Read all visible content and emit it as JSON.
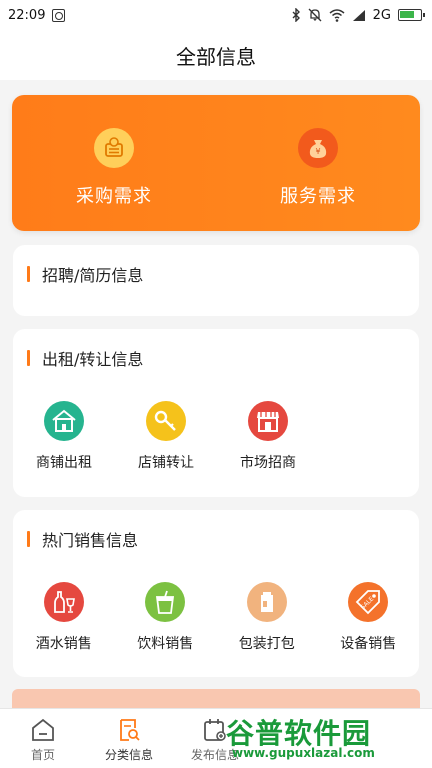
{
  "status_bar": {
    "time": "22:09",
    "network": "2G"
  },
  "title": "全部信息",
  "promo": [
    {
      "label": "采购需求",
      "icon": "purchase-icon"
    },
    {
      "label": "服务需求",
      "icon": "money-bag-icon"
    }
  ],
  "recruit": {
    "title": "招聘/简历信息"
  },
  "rent": {
    "title": "出租/转让信息",
    "items": [
      {
        "label": "商铺出租",
        "icon": "house-icon"
      },
      {
        "label": "店铺转让",
        "icon": "key-icon"
      },
      {
        "label": "市场招商",
        "icon": "storefront-icon"
      }
    ]
  },
  "hot": {
    "title": "热门销售信息",
    "items": [
      {
        "label": "酒水销售",
        "icon": "bottle-glass-icon"
      },
      {
        "label": "饮料销售",
        "icon": "drink-cup-icon"
      },
      {
        "label": "包装打包",
        "icon": "package-bag-icon"
      },
      {
        "label": "设备销售",
        "icon": "sale-tag-icon"
      }
    ]
  },
  "tabs": [
    {
      "label": "首页",
      "icon": "home-icon"
    },
    {
      "label": "分类信息",
      "icon": "category-search-icon"
    },
    {
      "label": "发布信息",
      "icon": "calendar-add-icon"
    }
  ],
  "watermark": {
    "brand": "谷普软件园",
    "url": "www.gupuxlazal.com"
  },
  "colors": {
    "accent": "#ff7a18",
    "promo": "#ff8a1e",
    "teal": "#26b48f",
    "yellow": "#f5c21b",
    "red": "#e5483f",
    "green": "#7cc141",
    "tan": "#f1b37e",
    "orange_tag": "#f4722b"
  }
}
